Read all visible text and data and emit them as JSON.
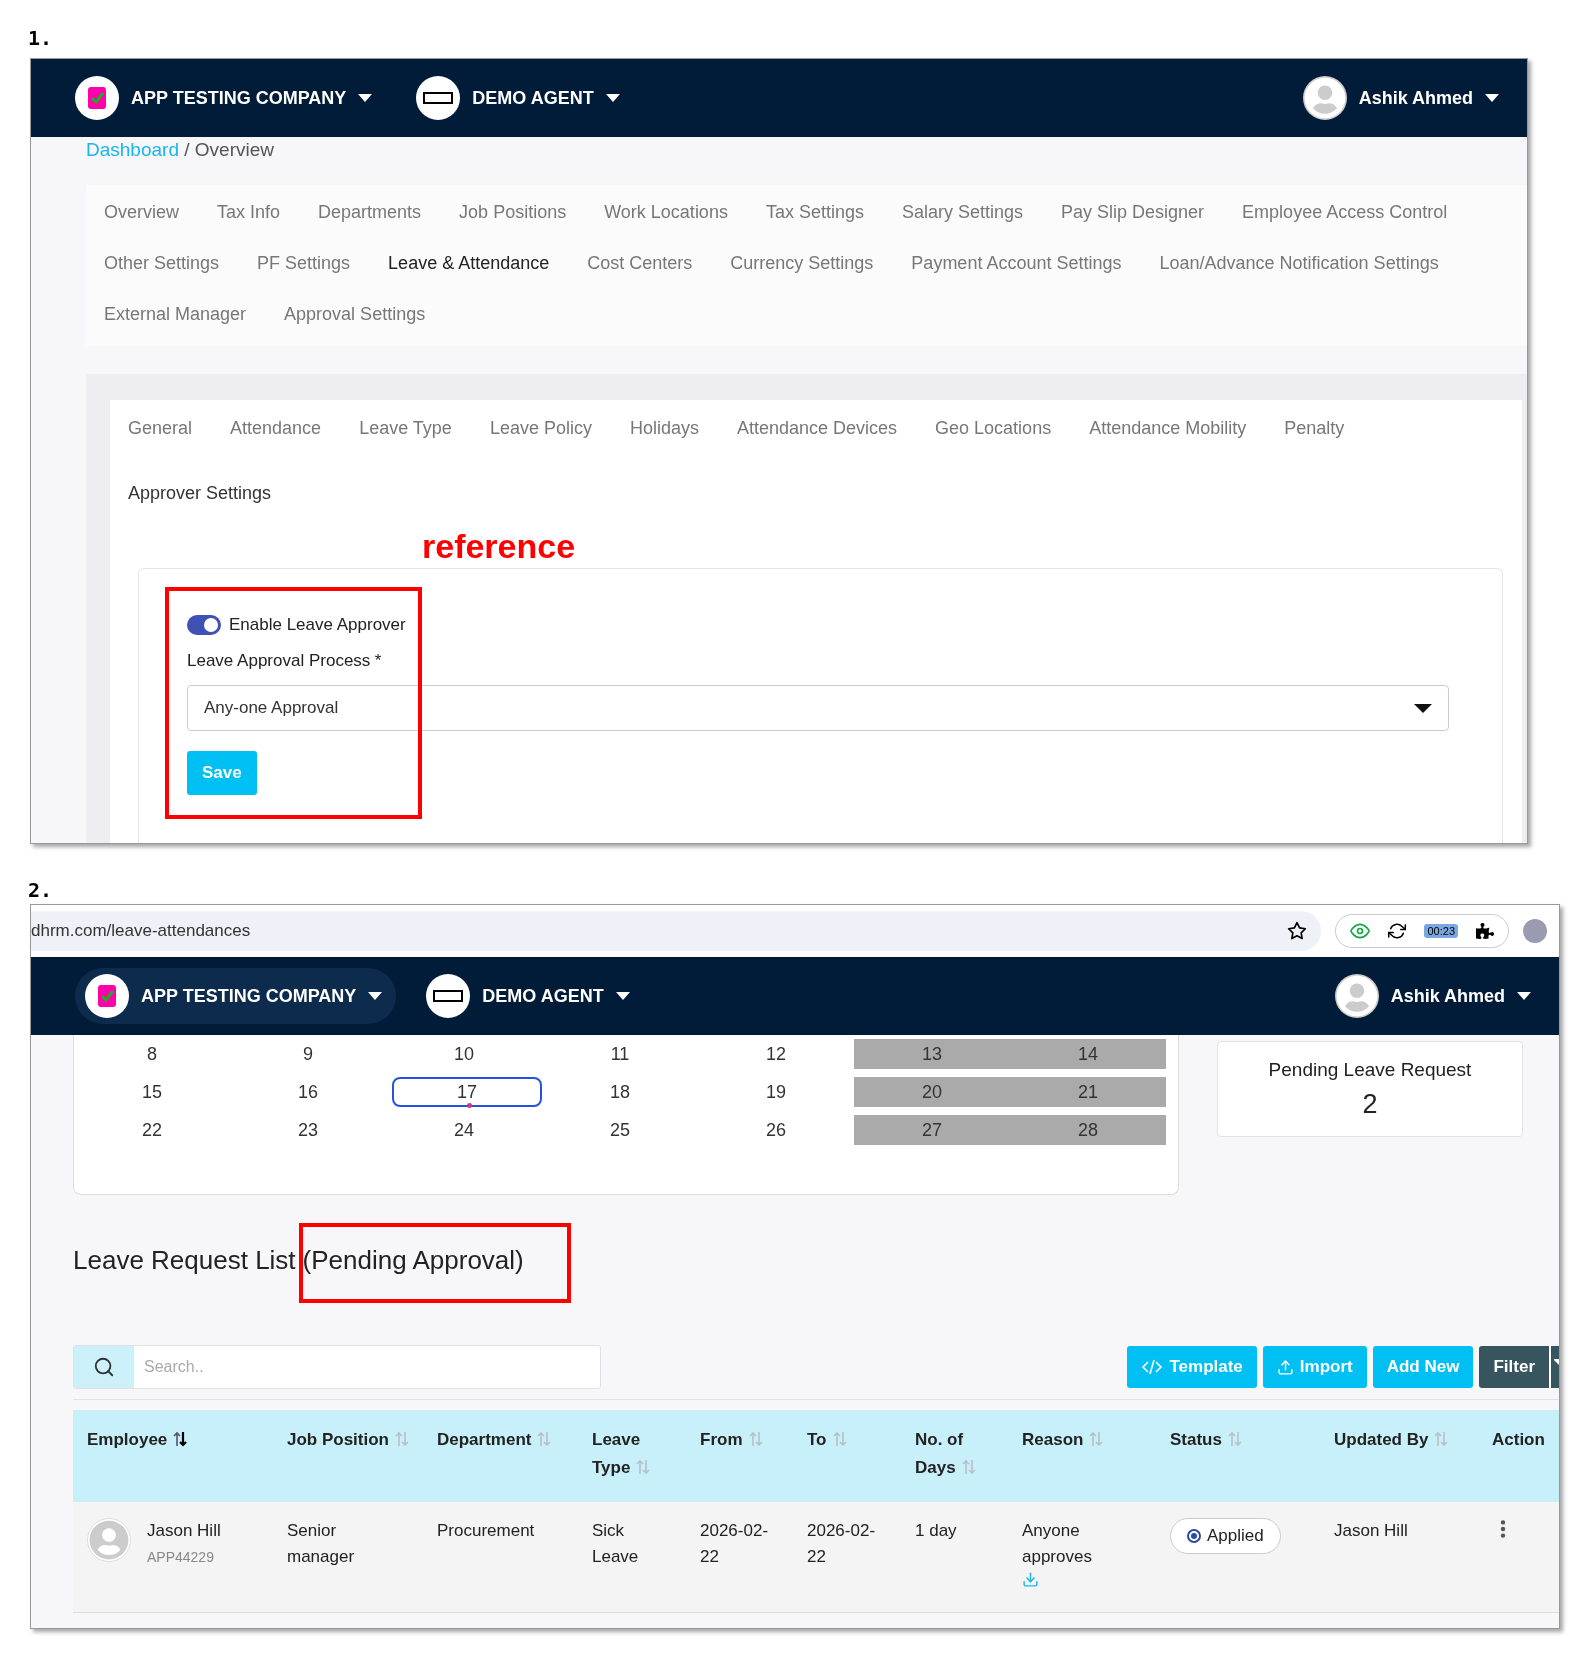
{
  "shot_1": {
    "number": "1.",
    "header": {
      "company": "APP TESTING COMPANY",
      "agent": "DEMO AGENT",
      "user": "Ashik Ahmed"
    },
    "breadcrumb": {
      "link": "Dashboard",
      "separator": "/",
      "current": "Overview"
    },
    "tabs": [
      {
        "label": "Overview",
        "selected": false
      },
      {
        "label": "Tax Info",
        "selected": false
      },
      {
        "label": "Departments",
        "selected": false
      },
      {
        "label": "Job Positions",
        "selected": false
      },
      {
        "label": "Work Locations",
        "selected": false
      },
      {
        "label": "Tax Settings",
        "selected": false
      },
      {
        "label": "Salary Settings",
        "selected": false
      },
      {
        "label": "Pay Slip Designer",
        "selected": false
      },
      {
        "label": "Employee Access Control",
        "selected": false
      },
      {
        "label": "Other Settings",
        "selected": false
      },
      {
        "label": "PF Settings",
        "selected": false
      },
      {
        "label": "Leave & Attendance",
        "selected": true
      },
      {
        "label": "Cost Centers",
        "selected": false
      },
      {
        "label": "Currency Settings",
        "selected": false
      },
      {
        "label": "Payment Account Settings",
        "selected": false
      },
      {
        "label": "Loan/Advance Notification Settings",
        "selected": false
      },
      {
        "label": "External Manager",
        "selected": false
      },
      {
        "label": "Approval Settings",
        "selected": false
      }
    ],
    "sub_tabs": [
      {
        "label": "General",
        "selected": false
      },
      {
        "label": "Attendance",
        "selected": false
      },
      {
        "label": "Leave Type",
        "selected": false
      },
      {
        "label": "Leave Policy",
        "selected": false
      },
      {
        "label": "Holidays",
        "selected": false
      },
      {
        "label": "Attendance Devices",
        "selected": false
      },
      {
        "label": "Geo Locations",
        "selected": false
      },
      {
        "label": "Attendance Mobility",
        "selected": false
      },
      {
        "label": "Penalty",
        "selected": false
      },
      {
        "label": "Approver Settings",
        "selected": true
      }
    ],
    "annotation": "reference",
    "form": {
      "toggle": {
        "label": "Enable Leave Approver",
        "on": true
      },
      "field_label": "Leave Approval Process",
      "required": "*",
      "select_value": "Any-one Approval",
      "save": "Save"
    }
  },
  "shot_2": {
    "number": "2.",
    "browser": {
      "url": "dhrm.com/leave-attendances",
      "timer": "00:23"
    },
    "header": {
      "company": "APP TESTING COMPANY",
      "agent": "DEMO AGENT",
      "user": "Ashik Ahmed"
    },
    "calendar": [
      [
        {
          "day": "8",
          "weekend": false,
          "selected": false,
          "event": false
        },
        {
          "day": "9",
          "weekend": false,
          "selected": false,
          "event": false
        },
        {
          "day": "10",
          "weekend": false,
          "selected": false,
          "event": false
        },
        {
          "day": "11",
          "weekend": false,
          "selected": false,
          "event": false
        },
        {
          "day": "12",
          "weekend": false,
          "selected": false,
          "event": false
        },
        {
          "day": "13",
          "weekend": true,
          "selected": false,
          "event": false
        },
        {
          "day": "14",
          "weekend": true,
          "selected": false,
          "event": false
        }
      ],
      [
        {
          "day": "15",
          "weekend": false,
          "selected": false,
          "event": false
        },
        {
          "day": "16",
          "weekend": false,
          "selected": false,
          "event": false
        },
        {
          "day": "17",
          "weekend": false,
          "selected": true,
          "event": true
        },
        {
          "day": "18",
          "weekend": false,
          "selected": false,
          "event": false
        },
        {
          "day": "19",
          "weekend": false,
          "selected": false,
          "event": false
        },
        {
          "day": "20",
          "weekend": true,
          "selected": false,
          "event": false
        },
        {
          "day": "21",
          "weekend": true,
          "selected": false,
          "event": false
        }
      ],
      [
        {
          "day": "22",
          "weekend": false,
          "selected": false,
          "event": false
        },
        {
          "day": "23",
          "weekend": false,
          "selected": false,
          "event": false
        },
        {
          "day": "24",
          "weekend": false,
          "selected": false,
          "event": false
        },
        {
          "day": "25",
          "weekend": false,
          "selected": false,
          "event": false
        },
        {
          "day": "26",
          "weekend": false,
          "selected": false,
          "event": false
        },
        {
          "day": "27",
          "weekend": true,
          "selected": false,
          "event": false
        },
        {
          "day": "28",
          "weekend": true,
          "selected": false,
          "event": false
        }
      ]
    ],
    "pending": {
      "title": "Pending Leave Request",
      "count": "2"
    },
    "list_title": "Leave Request List",
    "list_subtitle": "(Pending Approval)",
    "search": {
      "placeholder": "Search.."
    },
    "buttons": [
      {
        "label": "Template",
        "kind": "template"
      },
      {
        "label": "Import",
        "kind": "import"
      },
      {
        "label": "Add New",
        "kind": "plain"
      },
      {
        "label": "Filter",
        "kind": "filter"
      }
    ],
    "columns": [
      {
        "label": "Employee",
        "sortable": true,
        "sorted": true
      },
      {
        "label": "Job Position",
        "sortable": true,
        "sorted": false
      },
      {
        "label": "Department",
        "sortable": true,
        "sorted": false
      },
      {
        "label": "Leave Type",
        "sortable": true,
        "sorted": false
      },
      {
        "label": "From",
        "sortable": true,
        "sorted": false
      },
      {
        "label": "To",
        "sortable": true,
        "sorted": false
      },
      {
        "label": "No. of Days",
        "sortable": true,
        "sorted": false
      },
      {
        "label": "Reason",
        "sortable": true,
        "sorted": false
      },
      {
        "label": "Status",
        "sortable": true,
        "sorted": false
      },
      {
        "label": "Updated By",
        "sortable": true,
        "sorted": false
      },
      {
        "label": "Action",
        "sortable": false
      }
    ],
    "rows": [
      {
        "name": "Jason Hill",
        "id": "APP44229",
        "job": "Senior manager",
        "department": "Procurement",
        "leave_type": "Sick Leave",
        "from": "2026-02-22",
        "to": "2026-02-22",
        "days": "1 day",
        "reason": "Anyone approves",
        "status": "Applied",
        "updated_by": "Jason Hill"
      }
    ]
  }
}
